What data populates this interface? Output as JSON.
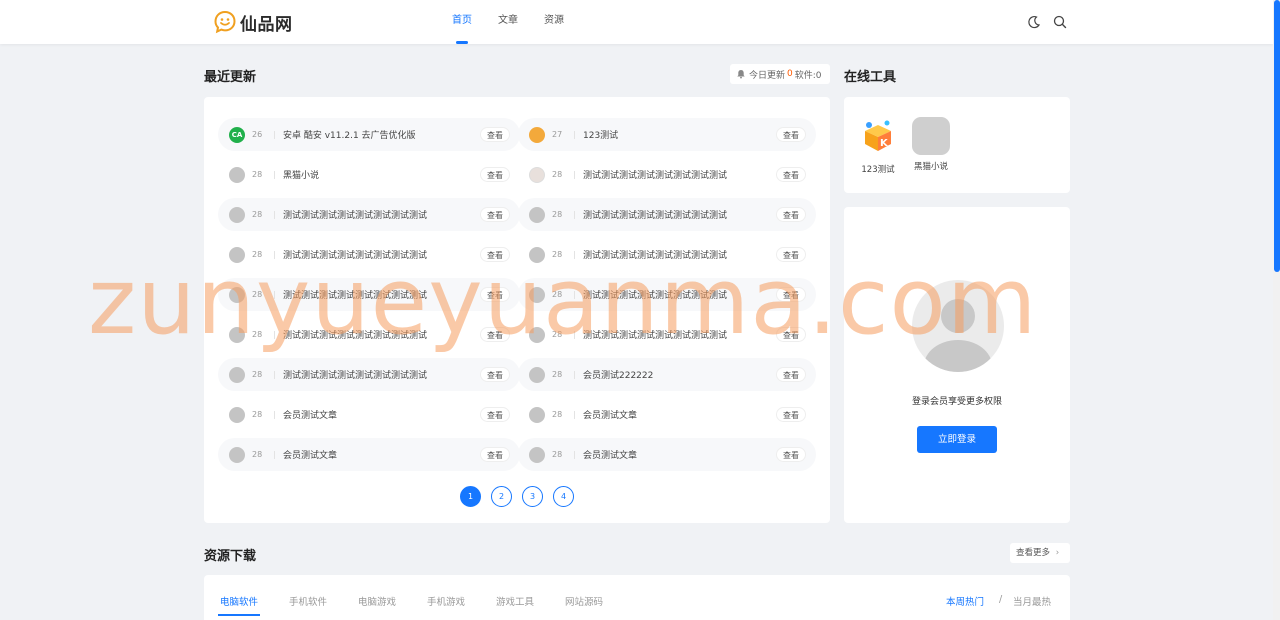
{
  "header": {
    "logo_text": "仙品网",
    "nav": [
      "首页",
      "文章",
      "资源"
    ],
    "icons": [
      "moon-icon",
      "search-icon"
    ]
  },
  "recent": {
    "title": "最近更新",
    "badge": {
      "label": "今日更新",
      "today_count": "0",
      "software_label": "软件:0"
    },
    "view_label": "查看",
    "items": [
      {
        "count": "26",
        "title": "安卓 酷安 v11.2.1 去广告优化版",
        "avatar": "coolapk-logo"
      },
      {
        "count": "27",
        "title": "123测试",
        "avatar": "orange-box"
      },
      {
        "count": "28",
        "title": "黑猫小说",
        "avatar": "gray"
      },
      {
        "count": "28",
        "title": "测试测试测试测试测试测试测试测试",
        "avatar": "photo"
      },
      {
        "count": "28",
        "title": "测试测试测试测试测试测试测试测试",
        "avatar": "gray"
      },
      {
        "count": "28",
        "title": "测试测试测试测试测试测试测试测试",
        "avatar": "gray"
      },
      {
        "count": "28",
        "title": "测试测试测试测试测试测试测试测试",
        "avatar": "gray"
      },
      {
        "count": "28",
        "title": "测试测试测试测试测试测试测试测试",
        "avatar": "gray"
      },
      {
        "count": "28",
        "title": "测试测试测试测试测试测试测试测试",
        "avatar": "gray"
      },
      {
        "count": "28",
        "title": "测试测试测试测试测试测试测试测试",
        "avatar": "gray"
      },
      {
        "count": "28",
        "title": "测试测试测试测试测试测试测试测试",
        "avatar": "gray"
      },
      {
        "count": "28",
        "title": "测试测试测试测试测试测试测试测试",
        "avatar": "gray"
      },
      {
        "count": "28",
        "title": "测试测试测试测试测试测试测试测试",
        "avatar": "gray"
      },
      {
        "count": "28",
        "title": "会员测试222222",
        "avatar": "gray"
      },
      {
        "count": "28",
        "title": "会员测试文章",
        "avatar": "gray"
      },
      {
        "count": "28",
        "title": "会员测试文章",
        "avatar": "gray"
      },
      {
        "count": "28",
        "title": "会员测试文章",
        "avatar": "gray"
      },
      {
        "count": "28",
        "title": "会员测试文章",
        "avatar": "gray"
      }
    ],
    "pages": [
      "1",
      "2",
      "3",
      "4"
    ],
    "current_page": "1"
  },
  "tools": {
    "title": "在线工具",
    "items": [
      {
        "label": "123测试",
        "icon": "orange-box-icon"
      },
      {
        "label": "黑猫小说",
        "icon": "gray-placeholder-icon"
      }
    ]
  },
  "login": {
    "prompt": "登录会员享受更多权限",
    "button": "立即登录"
  },
  "downloads": {
    "title": "资源下载",
    "more": "查看更多",
    "tabs": [
      "电脑软件",
      "手机软件",
      "电脑游戏",
      "手机游戏",
      "游戏工具",
      "网站源码"
    ],
    "hot_tabs": [
      "本周热门",
      "当月最热"
    ],
    "hot_separator": "/"
  },
  "watermark": "zunyueyuanma.com",
  "colors": {
    "accent": "#1677ff",
    "badge_number": "#ff5a00",
    "watermark": "#f69d5f"
  }
}
